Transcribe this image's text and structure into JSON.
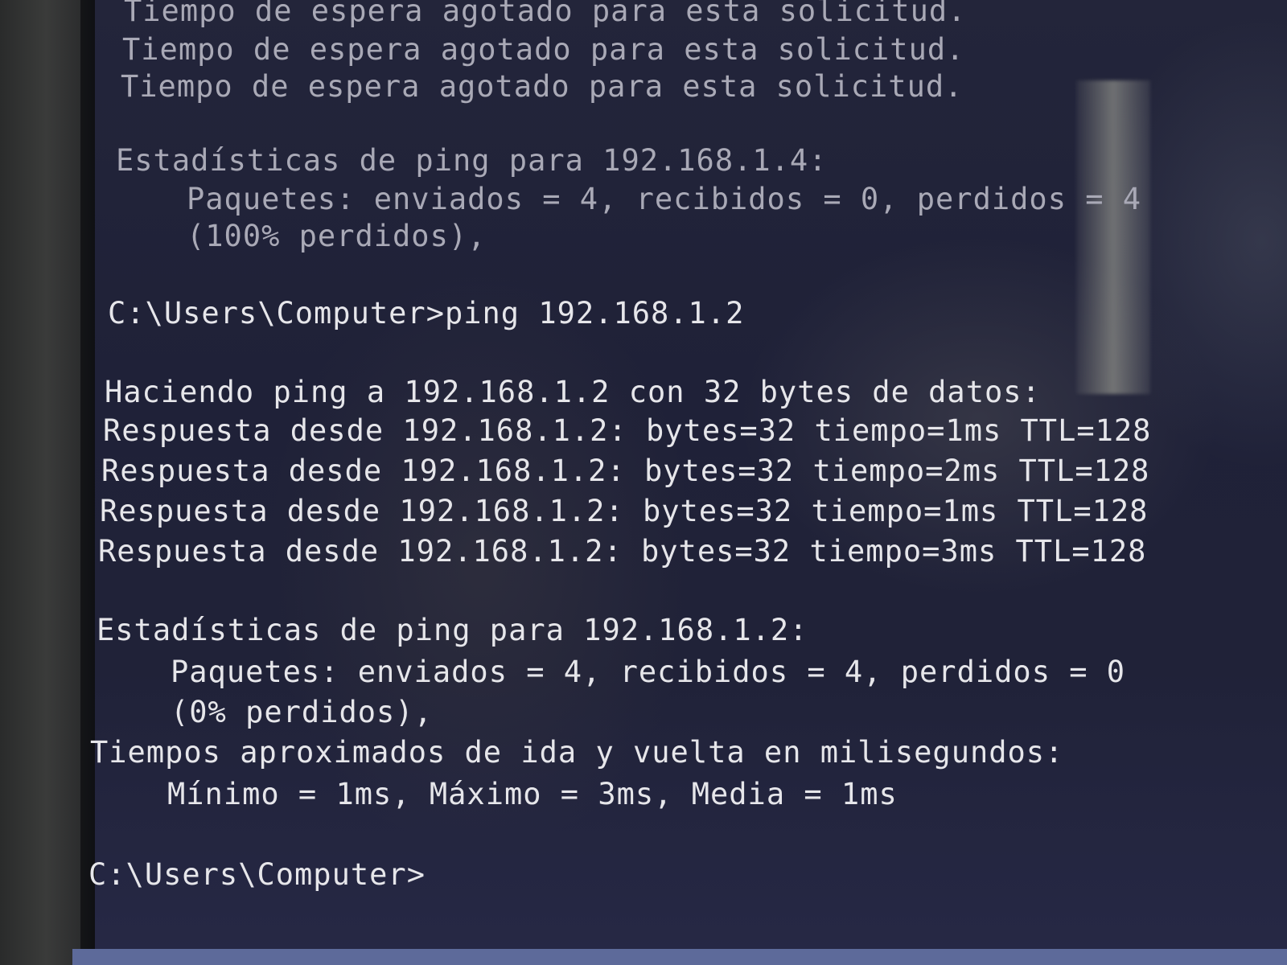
{
  "console": {
    "lines": [
      "Tiempo de espera agotado para esta solicitud.",
      "Tiempo de espera agotado para esta solicitud.",
      "Tiempo de espera agotado para esta solicitud.",
      "Estadísticas de ping para 192.168.1.4:",
      "Paquetes: enviados = 4, recibidos = 0, perdidos = 4",
      "(100% perdidos),",
      "C:\\Users\\Computer>ping 192.168.1.2",
      "Haciendo ping a 192.168.1.2 con 32 bytes de datos:",
      "Respuesta desde 192.168.1.2: bytes=32 tiempo=1ms TTL=128",
      "Respuesta desde 192.168.1.2: bytes=32 tiempo=2ms TTL=128",
      "Respuesta desde 192.168.1.2: bytes=32 tiempo=1ms TTL=128",
      "Respuesta desde 192.168.1.2: bytes=32 tiempo=3ms TTL=128",
      "Estadísticas de ping para 192.168.1.2:",
      "Paquetes: enviados = 4, recibidos = 4, perdidos = 0",
      "(0% perdidos),",
      "Tiempos aproximados de ida y vuelta en milisegundos:",
      "Mínimo = 1ms, Máximo = 3ms, Media = 1ms",
      "C:\\Users\\Computer>"
    ]
  }
}
